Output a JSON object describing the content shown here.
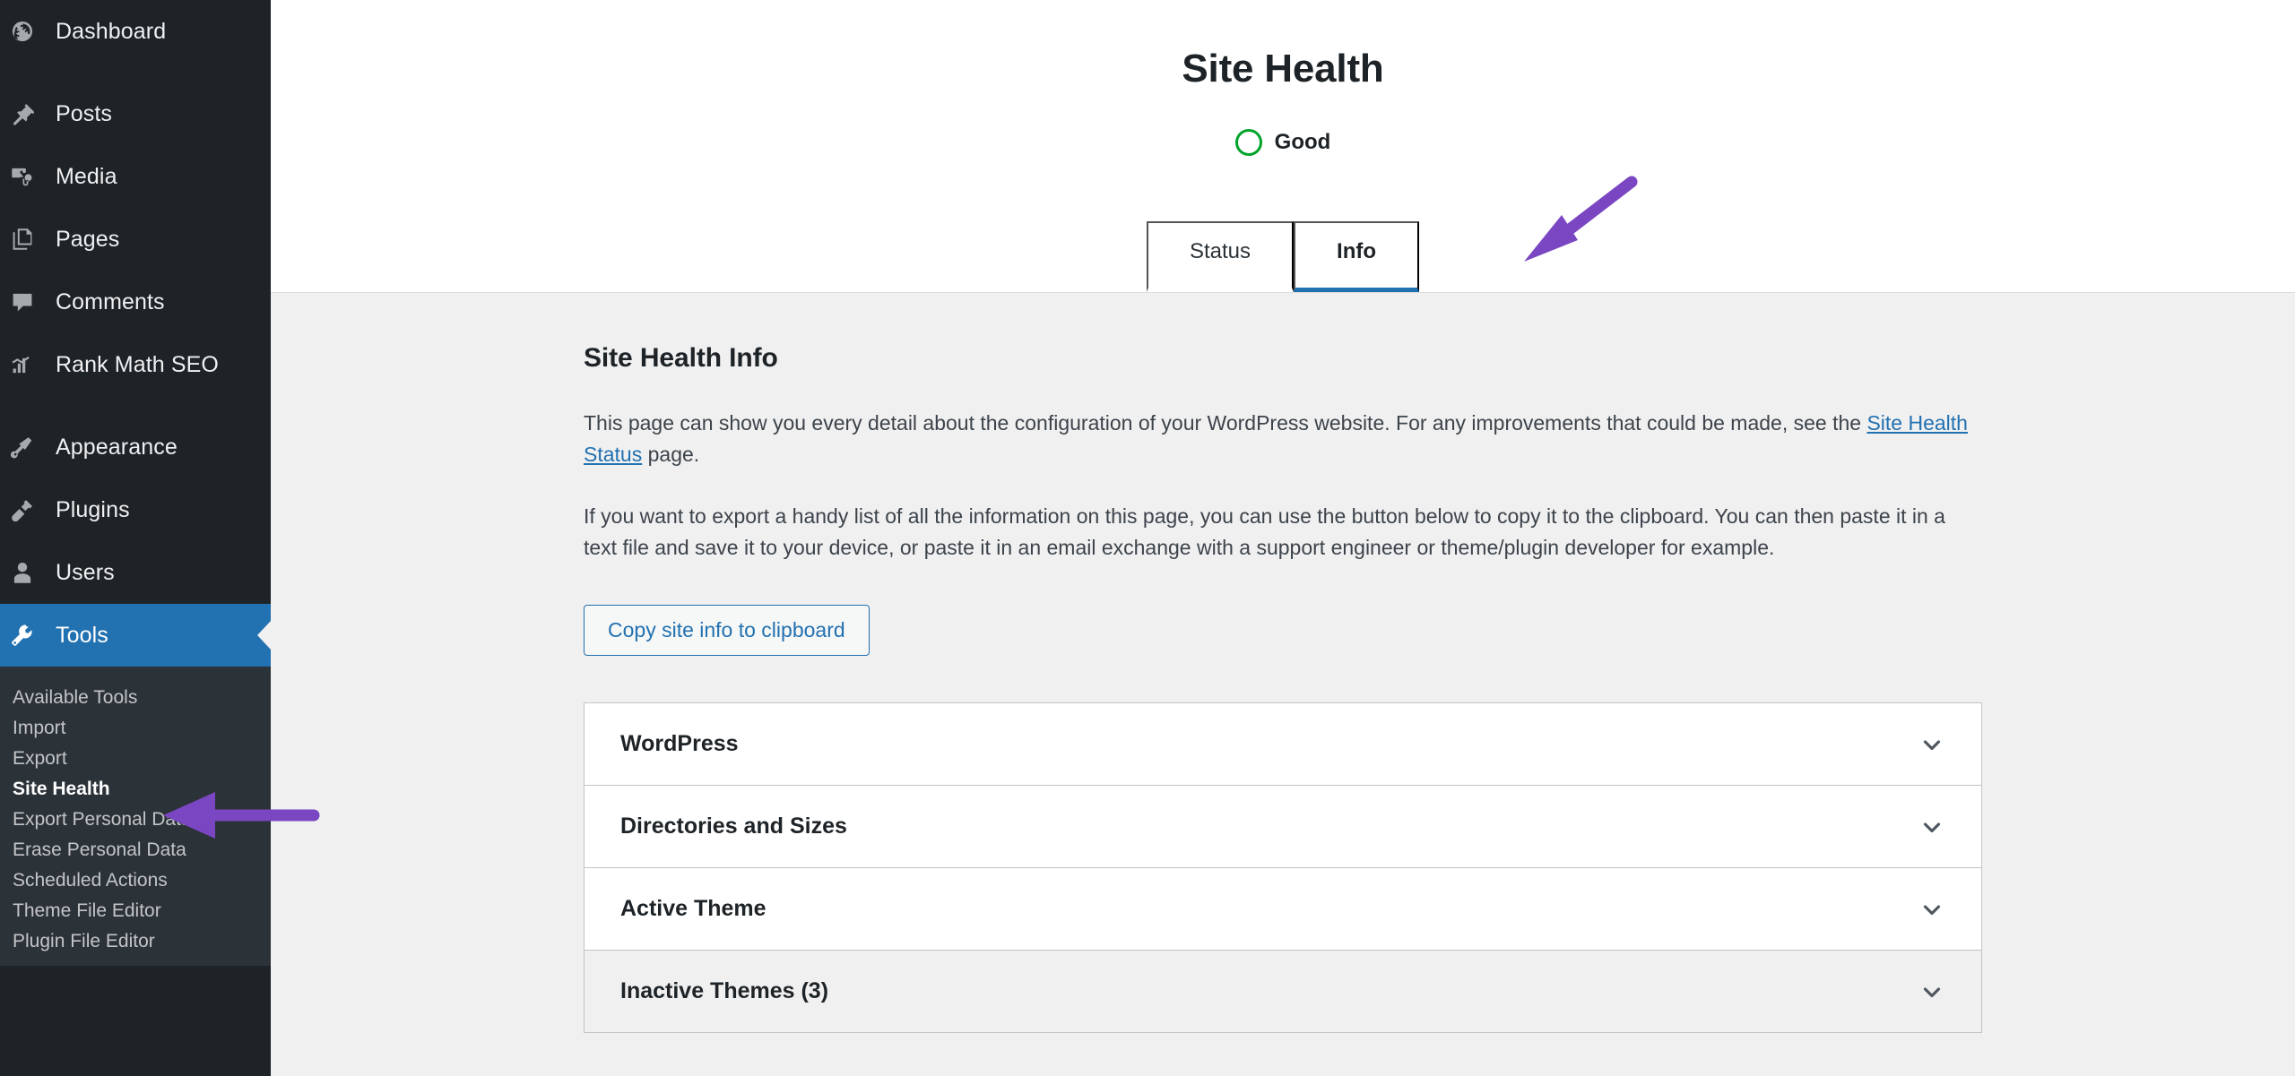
{
  "sidebar": {
    "items": [
      {
        "label": "Dashboard",
        "icon": "dashboard-icon",
        "current": false
      },
      {
        "label": "Posts",
        "icon": "pin-icon",
        "current": false,
        "gap_before": true
      },
      {
        "label": "Media",
        "icon": "media-icon",
        "current": false
      },
      {
        "label": "Pages",
        "icon": "pages-icon",
        "current": false
      },
      {
        "label": "Comments",
        "icon": "comments-icon",
        "current": false
      },
      {
        "label": "Rank Math SEO",
        "icon": "rank-math-icon",
        "current": false
      },
      {
        "label": "Appearance",
        "icon": "appearance-brush-icon",
        "current": false,
        "gap_before": true
      },
      {
        "label": "Plugins",
        "icon": "plugins-plug-icon",
        "current": false
      },
      {
        "label": "Users",
        "icon": "users-icon",
        "current": false
      },
      {
        "label": "Tools",
        "icon": "tools-wrench-icon",
        "current": true
      }
    ],
    "submenu": [
      {
        "label": "Available Tools",
        "current": false
      },
      {
        "label": "Import",
        "current": false
      },
      {
        "label": "Export",
        "current": false
      },
      {
        "label": "Site Health",
        "current": true
      },
      {
        "label": "Export Personal Data",
        "current": false
      },
      {
        "label": "Erase Personal Data",
        "current": false
      },
      {
        "label": "Scheduled Actions",
        "current": false
      },
      {
        "label": "Theme File Editor",
        "current": false
      },
      {
        "label": "Plugin File Editor",
        "current": false
      }
    ]
  },
  "header": {
    "title": "Site Health",
    "status_label": "Good",
    "status_color": "#00a32a",
    "tabs": [
      {
        "label": "Status",
        "active": false
      },
      {
        "label": "Info",
        "active": true
      }
    ],
    "accent_color": "#2271b1"
  },
  "main": {
    "section_title": "Site Health Info",
    "paragraph1_before": "This page can show you every detail about the configuration of your WordPress website. For any improvements that could be made, see the ",
    "paragraph1_link": "Site Health Status",
    "paragraph1_after": " page.",
    "paragraph2": "If you want to export a handy list of all the information on this page, you can use the button below to copy it to the clipboard. You can then paste it in a text file and save it to your device, or paste it in an email exchange with a support engineer or theme/plugin developer for example.",
    "copy_button": "Copy site info to clipboard",
    "accordion": [
      {
        "label": "WordPress",
        "hovered": false,
        "chevron": "chevron-down-icon"
      },
      {
        "label": "Directories and Sizes",
        "hovered": false,
        "chevron": "chevron-down-icon"
      },
      {
        "label": "Active Theme",
        "hovered": false,
        "chevron": "chevron-down-icon"
      },
      {
        "label": "Inactive Themes (3)",
        "hovered": true,
        "chevron": "chevron-down-icon"
      }
    ]
  },
  "annotations": {
    "color": "#7a46c1",
    "arrows": [
      {
        "name": "arrow-to-info-tab",
        "points_at": "Info"
      },
      {
        "name": "arrow-to-site-health-menu",
        "points_at": "Site Health"
      }
    ]
  }
}
